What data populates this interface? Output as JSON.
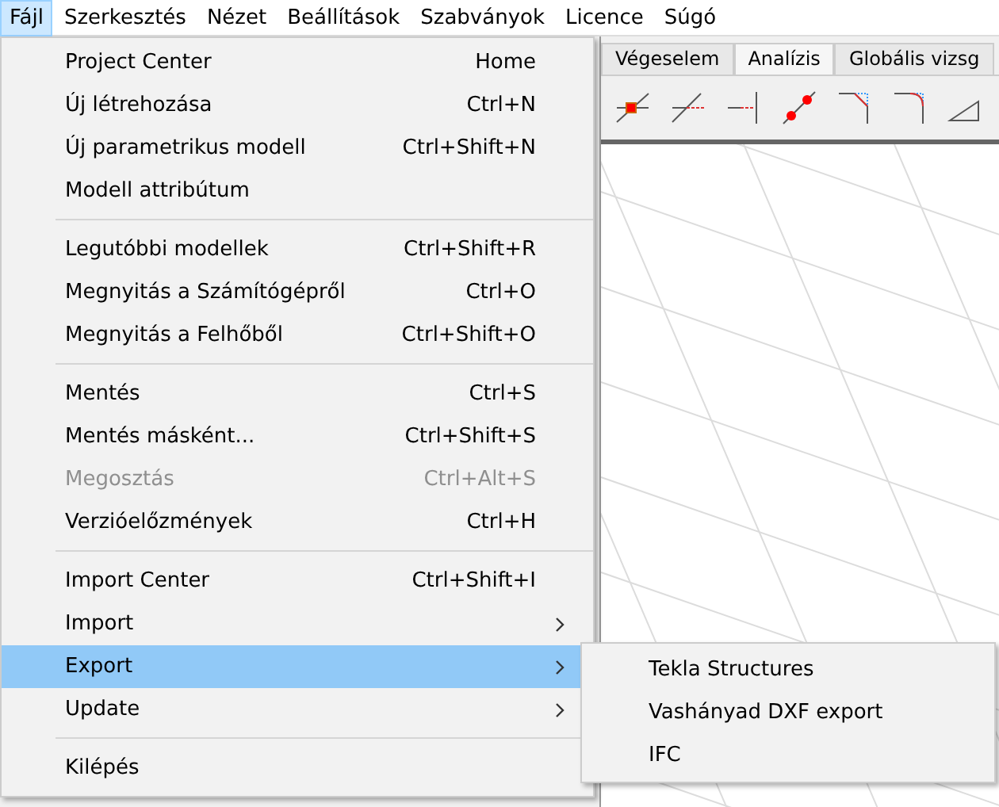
{
  "menubar": [
    {
      "label": "Fájl",
      "selected": true
    },
    {
      "label": "Szerkesztés",
      "selected": false
    },
    {
      "label": "Nézet",
      "selected": false
    },
    {
      "label": "Beállítások",
      "selected": false
    },
    {
      "label": "Szabványok",
      "selected": false
    },
    {
      "label": "Licence",
      "selected": false
    },
    {
      "label": "Súgó",
      "selected": false
    }
  ],
  "tabs": [
    {
      "label": "Végeselem",
      "selected": false
    },
    {
      "label": "Analízis",
      "selected": true
    },
    {
      "label": "Globális vizsg",
      "selected": false
    }
  ],
  "file_menu": {
    "groups": [
      [
        {
          "kind": "item",
          "label": "Project Center",
          "shortcut": "Home",
          "disabled": false,
          "selected": false
        },
        {
          "kind": "item",
          "label": "Új létrehozása",
          "shortcut": "Ctrl+N",
          "disabled": false,
          "selected": false
        },
        {
          "kind": "item",
          "label": "Új parametrikus modell",
          "shortcut": "Ctrl+Shift+N",
          "disabled": false,
          "selected": false
        },
        {
          "kind": "item",
          "label": "Modell attribútum",
          "disabled": false,
          "selected": false
        }
      ],
      [
        {
          "kind": "item",
          "label": "Legutóbbi modellek",
          "shortcut": "Ctrl+Shift+R",
          "disabled": false,
          "selected": false
        },
        {
          "kind": "item",
          "label": "Megnyitás a Számítógépről",
          "shortcut": "Ctrl+O",
          "disabled": false,
          "selected": false
        },
        {
          "kind": "item",
          "label": "Megnyitás a Felhőből",
          "shortcut": "Ctrl+Shift+O",
          "disabled": false,
          "selected": false
        }
      ],
      [
        {
          "kind": "item",
          "label": "Mentés",
          "shortcut": "Ctrl+S",
          "disabled": false,
          "selected": false
        },
        {
          "kind": "item",
          "label": "Mentés másként...",
          "shortcut": "Ctrl+Shift+S",
          "disabled": false,
          "selected": false
        },
        {
          "kind": "item",
          "label": "Megosztás",
          "shortcut": "Ctrl+Alt+S",
          "disabled": true,
          "selected": false
        },
        {
          "kind": "item",
          "label": "Verzióelőzmények",
          "shortcut": "Ctrl+H",
          "disabled": false,
          "selected": false
        }
      ],
      [
        {
          "kind": "item",
          "label": "Import Center",
          "shortcut": "Ctrl+Shift+I",
          "disabled": false,
          "selected": false
        },
        {
          "kind": "submenu",
          "label": "Import",
          "disabled": false,
          "selected": false
        },
        {
          "kind": "submenu",
          "label": "Export",
          "disabled": false,
          "selected": true
        },
        {
          "kind": "submenu",
          "label": "Update",
          "disabled": false,
          "selected": false
        }
      ],
      [
        {
          "kind": "item",
          "label": "Kilépés",
          "disabled": false,
          "selected": false
        }
      ]
    ]
  },
  "export_submenu": {
    "items": [
      {
        "label": "Tekla Structures"
      },
      {
        "label": "Vashányad DXF export"
      },
      {
        "label": "IFC"
      }
    ]
  }
}
